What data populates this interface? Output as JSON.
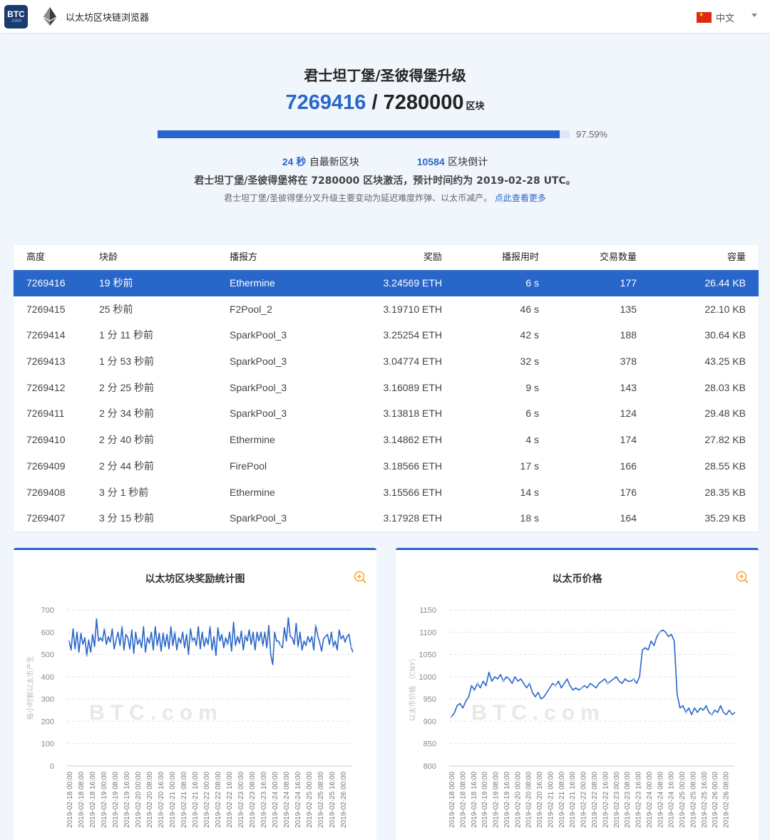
{
  "header": {
    "logo_line1": "BTC",
    "logo_line2": ".com",
    "site_name": "以太坊区块链浏览器",
    "language": "中文"
  },
  "hero": {
    "title": "君士坦丁堡/圣彼得堡升级",
    "current_block": "7269416",
    "separator": " / ",
    "target_block": "7280000",
    "unit": "区块",
    "progress": 0.9759,
    "progress_text": "97.59%",
    "latest_seconds": "24 秒",
    "latest_label": "自最新区块",
    "countdown_blocks": "10584",
    "countdown_label": "区块倒计",
    "activation_text": "君士坦丁堡/圣彼得堡将在 7280000 区块激活，预计时间约为 2019-02-28 UTC。",
    "note_text": "君士坦丁堡/圣彼得堡分叉升级主要变动为延迟难度炸弹、以太币减产。",
    "note_link": "点此查看更多"
  },
  "table": {
    "headers": [
      "高度",
      "块龄",
      "播报方",
      "奖励",
      "播报用时",
      "交易数量",
      "容量"
    ],
    "rows": [
      [
        "7269416",
        "19 秒前",
        "Ethermine",
        "3.24569 ETH",
        "6 s",
        "177",
        "26.44 KB"
      ],
      [
        "7269415",
        "25 秒前",
        "F2Pool_2",
        "3.19710 ETH",
        "46 s",
        "135",
        "22.10 KB"
      ],
      [
        "7269414",
        "1 分 11 秒前",
        "SparkPool_3",
        "3.25254 ETH",
        "42 s",
        "188",
        "30.64 KB"
      ],
      [
        "7269413",
        "1 分 53 秒前",
        "SparkPool_3",
        "3.04774 ETH",
        "32 s",
        "378",
        "43.25 KB"
      ],
      [
        "7269412",
        "2 分 25 秒前",
        "SparkPool_3",
        "3.16089 ETH",
        "9 s",
        "143",
        "28.03 KB"
      ],
      [
        "7269411",
        "2 分 34 秒前",
        "SparkPool_3",
        "3.13818 ETH",
        "6 s",
        "124",
        "29.48 KB"
      ],
      [
        "7269410",
        "2 分 40 秒前",
        "Ethermine",
        "3.14862 ETH",
        "4 s",
        "174",
        "27.82 KB"
      ],
      [
        "7269409",
        "2 分 44 秒前",
        "FirePool",
        "3.18566 ETH",
        "17 s",
        "166",
        "28.55 KB"
      ],
      [
        "7269408",
        "3 分 1 秒前",
        "Ethermine",
        "3.15566 ETH",
        "14 s",
        "176",
        "28.35 KB"
      ],
      [
        "7269407",
        "3 分 15 秒前",
        "SparkPool_3",
        "3.17928 ETH",
        "18 s",
        "164",
        "35.29 KB"
      ]
    ]
  },
  "colors": {
    "accent": "#2966c9",
    "zoom": "#f5a623"
  },
  "chart_data": [
    {
      "type": "line",
      "title": "以太坊区块奖励统计图",
      "ylabel": "每小时新以太币产生",
      "xlabel": "",
      "watermark": "BTC.com",
      "ylim": [
        0,
        700
      ],
      "yticks": [
        0,
        100,
        200,
        300,
        400,
        500,
        600,
        700
      ],
      "x_tick_labels": [
        "2019-02-18 00:00",
        "2019-02-18 08:00",
        "2019-02-18 16:00",
        "2019-02-19 00:00",
        "2019-02-19 08:00",
        "2019-02-19 16:00",
        "2019-02-20 00:00",
        "2019-02-20 08:00",
        "2019-02-20 16:00",
        "2019-02-21 00:00",
        "2019-02-21 08:00",
        "2019-02-21 16:00",
        "2019-02-22 00:00",
        "2019-02-22 08:00",
        "2019-02-22 16:00",
        "2019-02-23 00:00",
        "2019-02-23 08:00",
        "2019-02-23 16:00",
        "2019-02-24 00:00",
        "2019-02-24 08:00",
        "2019-02-24 16:00",
        "2019-02-25 00:00",
        "2019-02-25 08:00",
        "2019-02-25 16:00",
        "2019-02-26 00:00"
      ],
      "grid": true,
      "series": [
        {
          "values": [
            560,
            520,
            615,
            525,
            600,
            510,
            595,
            545,
            575,
            495,
            565,
            510,
            590,
            535,
            660,
            560,
            575,
            560,
            615,
            545,
            580,
            555,
            615,
            525,
            565,
            600,
            540,
            625,
            520,
            590,
            575,
            525,
            610,
            505,
            600,
            545,
            570,
            530,
            625,
            510,
            575,
            550,
            600,
            520,
            625,
            540,
            595,
            515,
            595,
            535,
            590,
            525,
            625,
            540,
            600,
            520,
            575,
            550,
            600,
            530,
            590,
            500,
            615,
            560,
            575,
            540,
            625,
            525,
            600,
            535,
            575,
            545,
            625,
            520,
            580,
            495,
            620,
            560,
            590,
            530,
            575,
            545,
            600,
            515,
            645,
            540,
            580,
            550,
            605,
            520,
            585,
            560,
            610,
            545,
            600,
            520,
            600,
            560,
            600,
            540,
            600,
            530,
            630,
            500,
            455,
            600,
            560,
            560,
            540,
            530,
            620,
            560,
            665,
            580,
            575,
            545,
            640,
            535,
            600,
            520,
            560,
            540,
            580,
            555,
            580,
            520,
            630,
            585,
            555,
            515,
            570,
            580,
            590,
            545,
            600,
            535,
            560,
            520,
            610,
            570,
            585,
            555,
            580,
            590,
            535,
            510
          ]
        }
      ]
    },
    {
      "type": "line",
      "title": "以太币价格",
      "ylabel": "以太币价格 （CNY）",
      "xlabel": "",
      "watermark": "BTC.com",
      "ylim": [
        800,
        1150
      ],
      "yticks": [
        800,
        850,
        900,
        950,
        1000,
        1050,
        1100,
        1150
      ],
      "x_tick_labels": [
        "2019-02-18 00:00",
        "2019-02-18 08:00",
        "2019-02-18 16:00",
        "2019-02-19 00:00",
        "2019-02-19 08:00",
        "2019-02-19 16:00",
        "2019-02-20 00:00",
        "2019-02-20 08:00",
        "2019-02-20 16:00",
        "2019-02-21 00:00",
        "2019-02-21 08:00",
        "2019-02-21 16:00",
        "2019-02-22 00:00",
        "2019-02-22 08:00",
        "2019-02-22 16:00",
        "2019-02-23 00:00",
        "2019-02-23 08:00",
        "2019-02-23 16:00",
        "2019-02-24 00:00",
        "2019-02-24 08:00",
        "2019-02-24 16:00",
        "2019-02-25 00:00",
        "2019-02-25 08:00",
        "2019-02-25 16:00",
        "2019-02-26 00:00",
        "2019-02-26 08:00"
      ],
      "grid": true,
      "series": [
        {
          "values": [
            910,
            918,
            935,
            940,
            930,
            945,
            955,
            980,
            970,
            985,
            975,
            990,
            980,
            1010,
            990,
            1000,
            995,
            1005,
            990,
            1000,
            995,
            985,
            1000,
            990,
            995,
            985,
            975,
            985,
            965,
            955,
            965,
            950,
            955,
            965,
            975,
            985,
            980,
            990,
            975,
            985,
            995,
            980,
            970,
            975,
            970,
            975,
            980,
            975,
            985,
            980,
            975,
            985,
            990,
            995,
            985,
            990,
            995,
            1000,
            990,
            985,
            995,
            990,
            990,
            995,
            985,
            1000,
            1060,
            1065,
            1060,
            1080,
            1070,
            1090,
            1100,
            1105,
            1100,
            1090,
            1095,
            1080,
            960,
            930,
            935,
            920,
            930,
            915,
            930,
            920,
            930,
            925,
            935,
            920,
            915,
            925,
            920,
            935,
            920,
            915,
            925,
            915,
            920
          ]
        }
      ]
    }
  ]
}
